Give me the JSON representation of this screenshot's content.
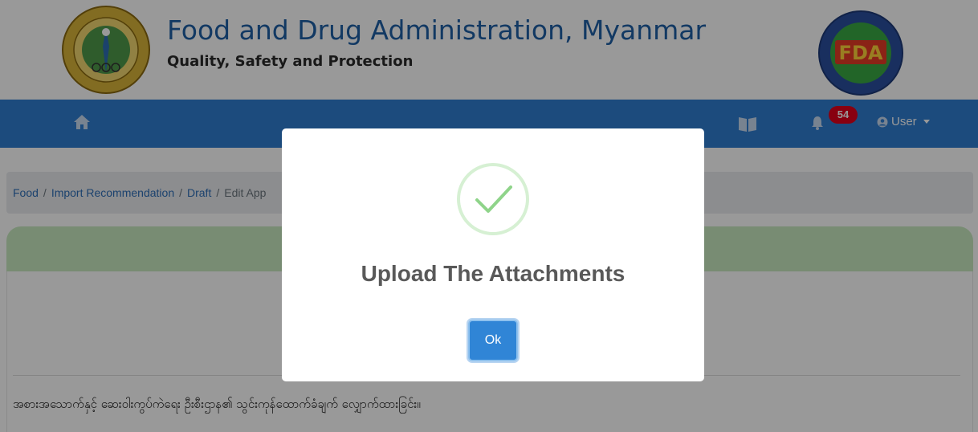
{
  "header": {
    "title": "Food and Drug Administration, Myanmar",
    "subtitle": "Quality, Safety and Protection",
    "logo_left_icon": "ministry-of-health-and-sports-seal-icon",
    "logo_right_icon": "fda-seal-icon",
    "logo_right_text": "FDA"
  },
  "navbar": {
    "home_icon": "home-icon",
    "book_icon": "book-icon",
    "bell_icon": "bell-icon",
    "notification_count": "54",
    "user_label": "User",
    "colors": {
      "bar": "#2f7dd1",
      "badge": "#e3001b"
    }
  },
  "breadcrumb": {
    "items": [
      "Food",
      "Import Recommendation",
      "Draft"
    ],
    "current": "Edit App"
  },
  "body": {
    "myanmar_text": "အစားအသောက်နှင့် ဆေးဝါးကွပ်ကဲရေး ဦးစီးဌာန၏ သွင်းကုန်ထောက်ခံချက် လျှောက်ထားခြင်း။"
  },
  "modal": {
    "icon": "success-check-icon",
    "title": "Upload The Attachments",
    "ok_label": "Ok",
    "colors": {
      "check": "#8fd48a",
      "button": "#3085d6"
    }
  }
}
